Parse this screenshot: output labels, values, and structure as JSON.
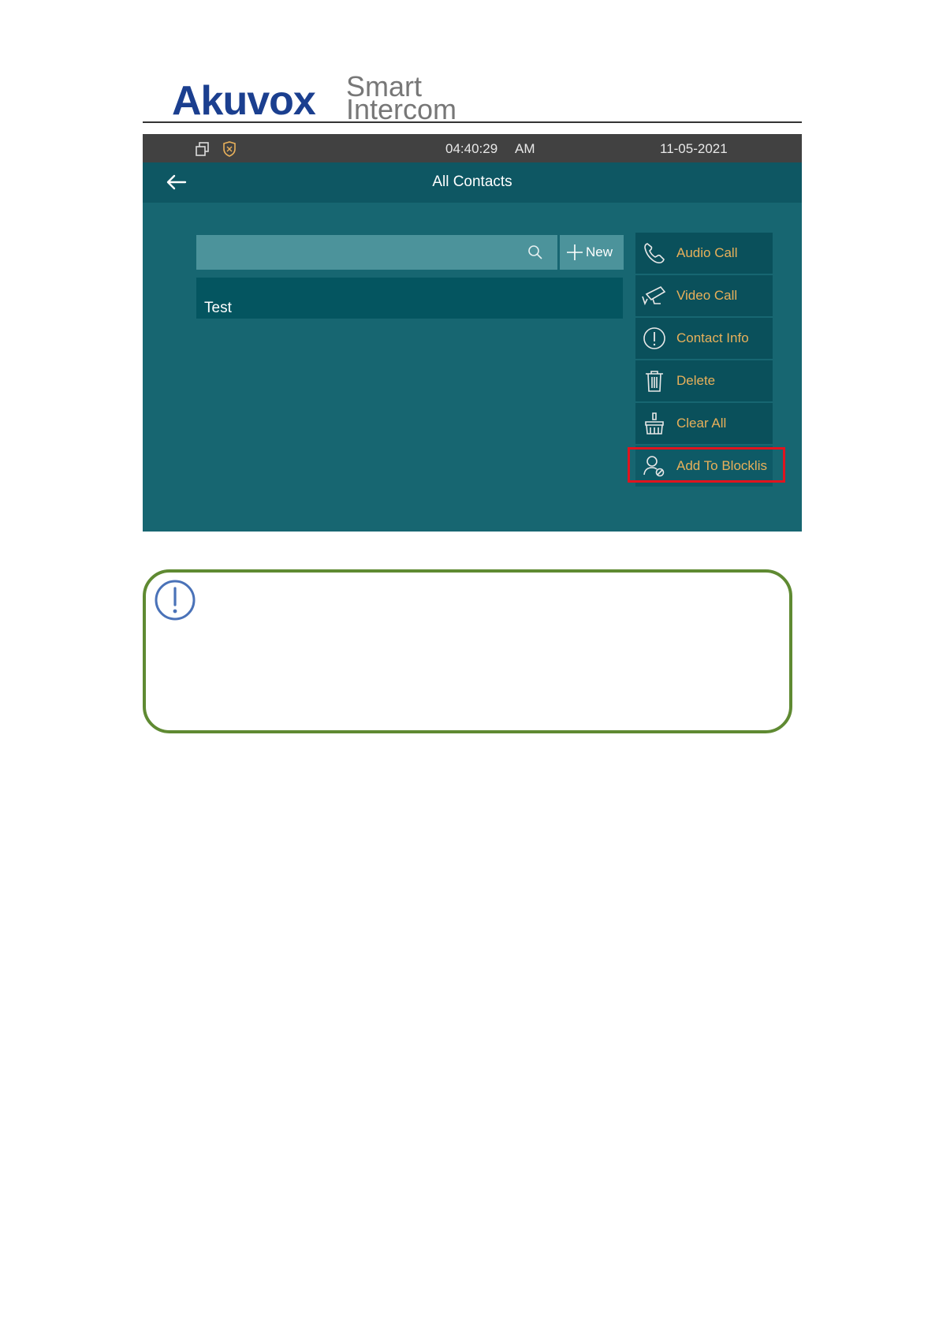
{
  "header": {
    "brand": "Akuvox",
    "tagline_1": "Smart",
    "tagline_2": "Intercom"
  },
  "statusbar": {
    "time": "04:40:29",
    "ampm": "AM",
    "date": "11-05-2021",
    "icons": [
      "window-switch-icon",
      "shield-icon"
    ]
  },
  "titlebar": {
    "title": "All Contacts",
    "back_icon": "back-arrow-icon"
  },
  "search": {
    "value": "",
    "icon": "search-icon"
  },
  "new_button": {
    "label": "New",
    "icon": "plus-icon"
  },
  "contacts": [
    {
      "name": "Test"
    }
  ],
  "menu": {
    "items": [
      {
        "label": "Audio Call",
        "icon": "phone-icon"
      },
      {
        "label": "Video Call",
        "icon": "camera-icon"
      },
      {
        "label": "Contact Info",
        "icon": "info-icon"
      },
      {
        "label": "Delete",
        "icon": "trash-icon"
      },
      {
        "label": "Clear All",
        "icon": "broom-icon"
      },
      {
        "label": "Add To Blocklis",
        "icon": "user-block-icon",
        "highlighted": true
      }
    ]
  },
  "note": {
    "icon": "exclamation-icon",
    "text": ""
  },
  "colors": {
    "screen_bg": "#176671",
    "titlebar_bg": "#0e5763",
    "statusbar_bg": "#414141",
    "menu_text": "#e8b05a",
    "highlight_border": "#e0141e",
    "note_border": "#5f8a32",
    "brand_blue": "#1b3f8f"
  }
}
